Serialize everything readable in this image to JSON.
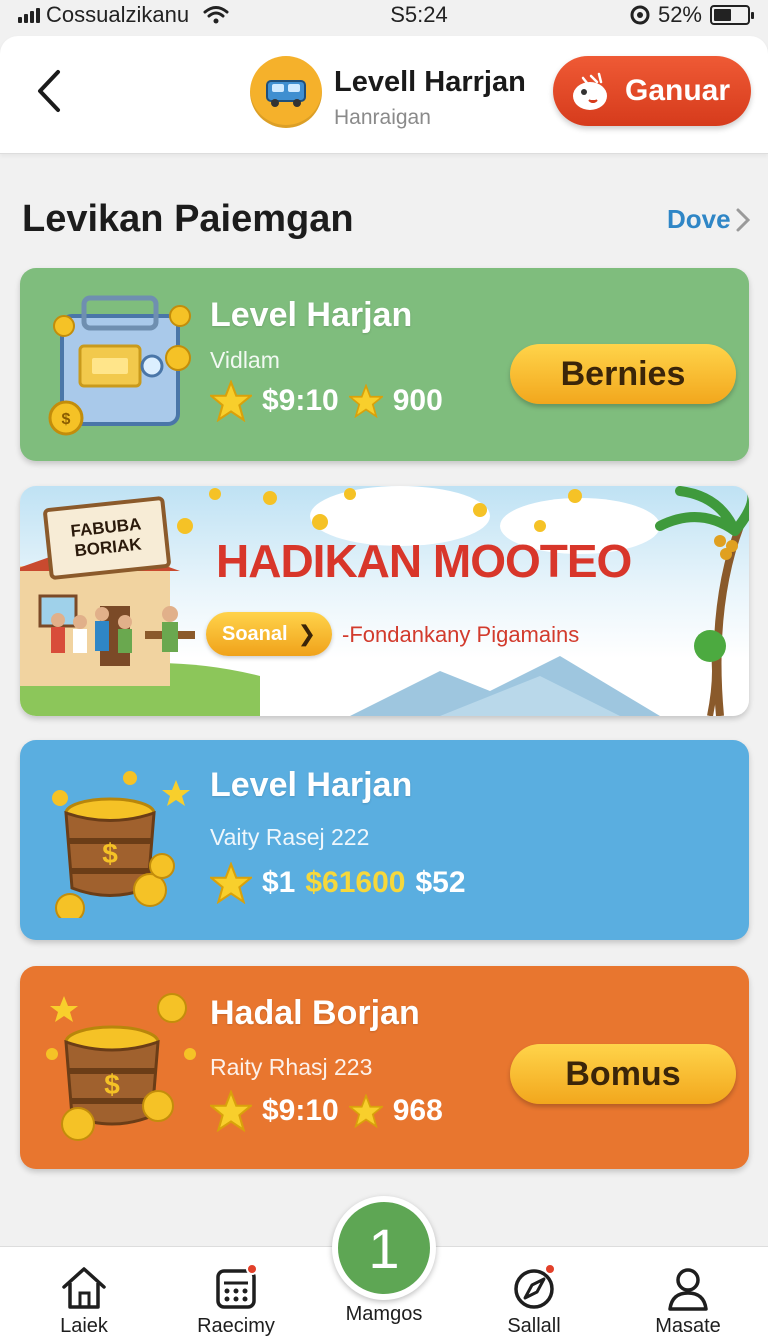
{
  "status_bar": {
    "carrier": "Cossualzikanu",
    "time": "S5:24",
    "battery_percent": "52%",
    "battery_level": 0.52,
    "icons": [
      "signal-icon",
      "wifi-icon",
      "location-icon",
      "battery-icon"
    ]
  },
  "header": {
    "title": "Levell Harrjan",
    "subtitle": "Hanraigan",
    "action_label": "Ganuar",
    "icons": [
      "back-icon",
      "car-icon",
      "mascot-icon"
    ]
  },
  "section": {
    "title": "Levikan Paiemgan",
    "link": "Dove"
  },
  "cards": [
    {
      "title": "Level Harjan",
      "subtitle": "Vidlam",
      "stat1": "$9:10",
      "stat2": "900",
      "button": "Bernies",
      "color": "#7fbd7d",
      "icon": "cash-register-icon"
    },
    {
      "title": "Level Harjan",
      "subtitle": "Vaity Rasej 222",
      "stat1": "$1",
      "stat1_highlight": "$61600",
      "stat2": "$52",
      "color": "#5aaee0",
      "icon": "coin-barrel-icon"
    },
    {
      "title": "Hadal Borjan",
      "subtitle": "Raity Rhasj 223",
      "stat1": "$9:10",
      "stat2": "968",
      "button": "Bomus",
      "color": "#e8762f",
      "icon": "coin-barrel-icon"
    }
  ],
  "banner": {
    "sign_line1": "FABUBA",
    "sign_line2": "BORIAK",
    "headline": "HADIKAN MOOTEO",
    "button_label": "Soanal",
    "tagline": "-Fondankany Pigamains"
  },
  "bottom_nav": {
    "items": [
      {
        "label": "Laiek",
        "icon": "home-icon"
      },
      {
        "label": "Raecimy",
        "icon": "calendar-icon",
        "badge": true
      },
      {
        "label": "Mamgos",
        "icon": "center-action-icon"
      },
      {
        "label": "Sallall",
        "icon": "compass-icon",
        "badge": true
      },
      {
        "label": "Masate",
        "icon": "profile-icon"
      }
    ],
    "center_number": "1"
  },
  "colors": {
    "accent_red": "#e0472a",
    "link_blue": "#2f86c6",
    "button_gold": "#f6b92c",
    "green": "#7fbd7d",
    "blue": "#5aaee0",
    "orange": "#e8762f"
  }
}
